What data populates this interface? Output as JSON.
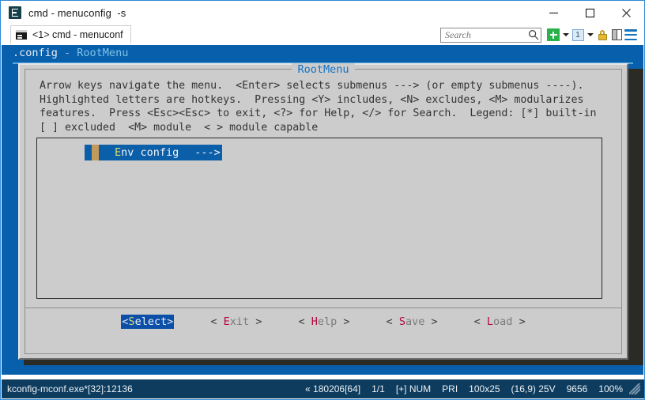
{
  "window": {
    "icon": "conemu-icon",
    "title": "cmd - menuconfig  -s",
    "minimize_label": "–",
    "maximize_label": "□",
    "close_label": "✕"
  },
  "tabbar": {
    "tab": {
      "icon": "console-icon",
      "label": "<1> cmd - menuconf"
    },
    "search": {
      "placeholder": "Search",
      "value": "",
      "icon": "search-icon"
    },
    "buttons": [
      {
        "name": "new-console-button",
        "icon": "green-plus-icon"
      },
      {
        "name": "new-console-dropdown",
        "icon": "chevron-down-icon"
      },
      {
        "name": "active-console-button",
        "icon": "console-number-icon",
        "label": "1"
      },
      {
        "name": "active-console-dropdown",
        "icon": "chevron-down-icon"
      },
      {
        "name": "admin-lock-button",
        "icon": "lock-icon"
      },
      {
        "name": "split-panel-button",
        "icon": "split-panel-icon"
      },
      {
        "name": "main-menu-button",
        "icon": "hamburger-menu-icon"
      }
    ]
  },
  "console": {
    "header": {
      "config": ".config",
      "separator": " - ",
      "menu": "RootMenu"
    },
    "dialog": {
      "title": "RootMenu",
      "help_lines": [
        "Arrow keys navigate the menu.  <Enter> selects submenus ---> (or empty submenus ----).",
        "Highlighted letters are hotkeys.  Pressing <Y> includes, <N> excludes, <M> modularizes",
        "features.  Press <Esc><Esc> to exit, <?> for Help, </> for Search.  Legend: [*] built-in",
        "[ ] excluded  <M> module  < > module capable"
      ],
      "menu_items": [
        {
          "marker": "selected-marker",
          "hotkey": "E",
          "rest": "nv config",
          "arrow": "--->",
          "selected": true
        }
      ],
      "buttons": [
        {
          "name": "select-button",
          "open": "<",
          "hotkey": "S",
          "rest": "elect",
          "close": ">",
          "selected": true
        },
        {
          "name": "exit-button",
          "open": "<",
          "hotkey": "E",
          "rest": "xit",
          "close": ">",
          "selected": false
        },
        {
          "name": "help-button",
          "open": "<",
          "hotkey": "H",
          "rest": "elp",
          "close": ">",
          "selected": false
        },
        {
          "name": "save-button",
          "open": "<",
          "hotkey": "S",
          "rest": "ave",
          "close": ">",
          "selected": false
        },
        {
          "name": "load-button",
          "open": "<",
          "hotkey": "L",
          "rest": "oad",
          "close": ">",
          "selected": false
        }
      ]
    }
  },
  "statusbar": {
    "process": "kconfig-mconf.exe*[32]:12136",
    "fields": [
      "« 180206[64]",
      "1/1",
      "[+] NUM",
      "PRI",
      "100x25",
      "(16,9) 25V",
      "9656",
      "100%"
    ],
    "grip": "resize-grip"
  },
  "colors": {
    "console_blue": "#0860ad",
    "dialog_gray": "#cccccc",
    "selection_blue": "#0b5ea8",
    "hotkey_red": "#b3093c",
    "hotkey_yellow": "#ddd96a",
    "statusbar": "#0e3c5e",
    "terminal_dark": "#2b2b26"
  }
}
